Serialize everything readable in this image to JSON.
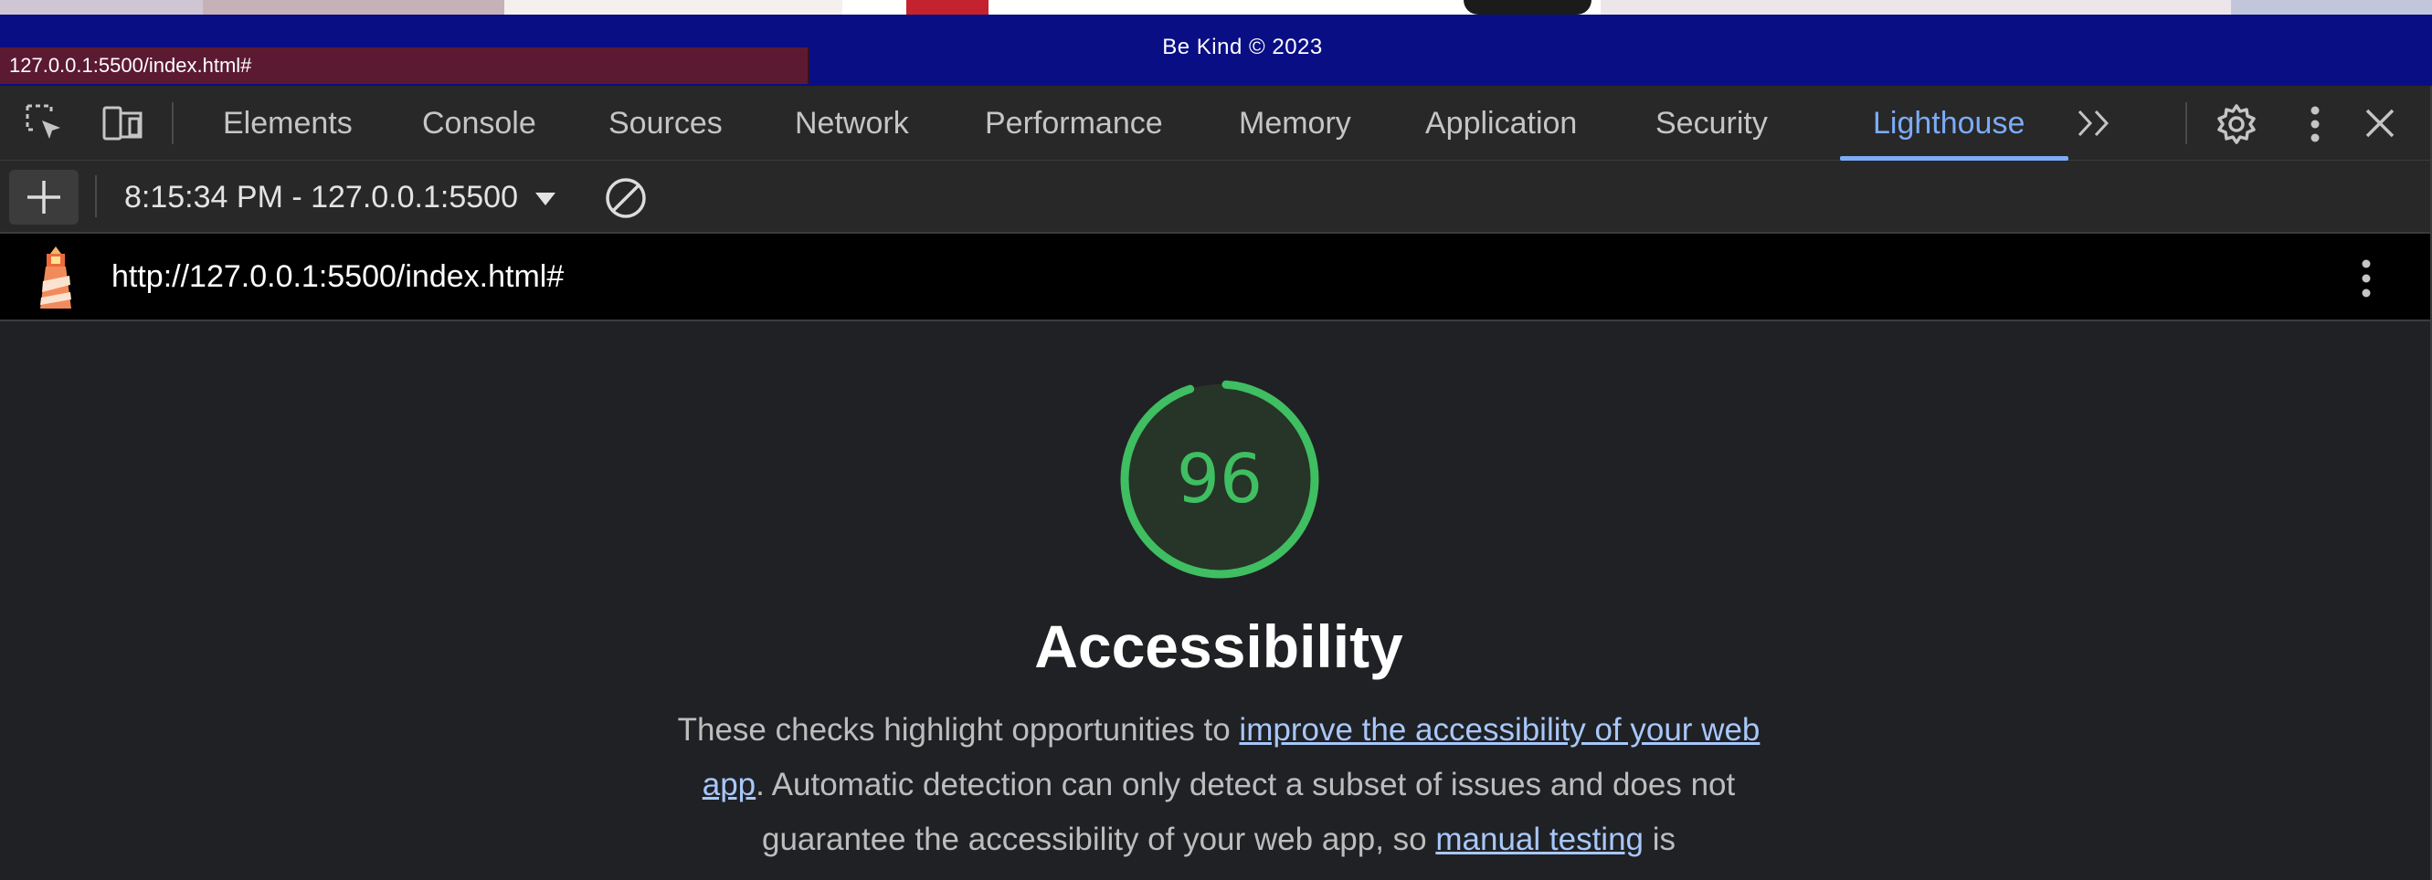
{
  "page": {
    "footer_text": "Be Kind © 2023",
    "status_url": "127.0.0.1:5500/index.html#"
  },
  "devtools": {
    "tabs": [
      {
        "label": "Elements"
      },
      {
        "label": "Console"
      },
      {
        "label": "Sources"
      },
      {
        "label": "Network"
      },
      {
        "label": "Performance"
      },
      {
        "label": "Memory"
      },
      {
        "label": "Application"
      },
      {
        "label": "Security"
      },
      {
        "label": "Lighthouse",
        "active": true
      }
    ],
    "accent_color": "#7cacf8",
    "icons": [
      "inspect-element-icon",
      "device-toolbar-icon",
      "more-tabs-icon",
      "settings-icon",
      "kebab-menu-icon",
      "close-icon"
    ]
  },
  "toolbar": {
    "report_select": "8:15:34 PM - 127.0.0.1:5500",
    "icons": [
      "plus-icon",
      "dropdown-arrow-icon",
      "clear-icon"
    ]
  },
  "report": {
    "url": "http://127.0.0.1:5500/index.html#",
    "score": "96",
    "score_color": "#3fbe62",
    "category_title": "Accessibility",
    "description": {
      "part1": "These checks highlight opportunities to ",
      "link1": "improve the accessibility of your web app",
      "part2": ". Automatic detection can only detect a subset of issues and does not guarantee the accessibility of your web app, so ",
      "link2": "manual testing",
      "part3": " is"
    },
    "icons": [
      "lighthouse-logo-icon",
      "kebab-menu-icon"
    ]
  }
}
